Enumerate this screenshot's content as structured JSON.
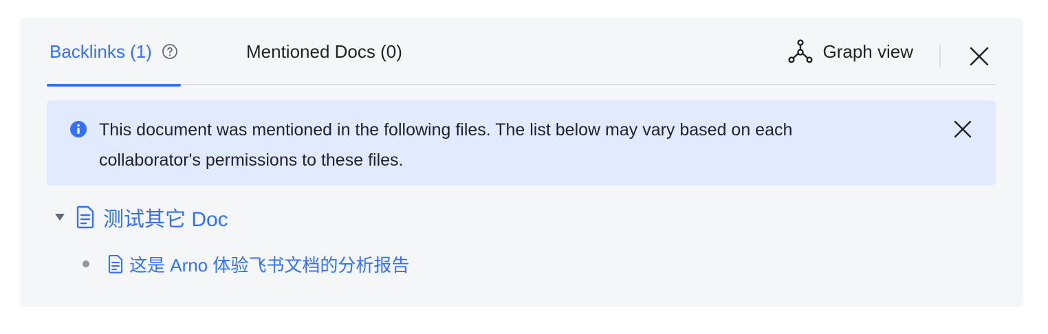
{
  "tabs": {
    "backlinks_label": "Backlinks (1)",
    "mentioned_label": "Mentioned Docs (0)"
  },
  "header": {
    "graph_view_label": "Graph view"
  },
  "notice": {
    "text": "This document was mentioned in the following files. The list below may vary based on each collaborator's permissions to these files."
  },
  "tree": {
    "root": {
      "title": "测试其它 Doc",
      "expanded": true,
      "children": [
        {
          "title": "这是 Arno 体验飞书文档的分析报告"
        }
      ]
    }
  },
  "colors": {
    "accent": "#3370ff",
    "panel_bg": "#f5f6f8",
    "notice_bg": "#e1eaff",
    "text": "#1f2329"
  },
  "icons": [
    "help-icon",
    "graph-icon",
    "close-icon",
    "info-icon",
    "caret-down-icon",
    "doc-icon"
  ]
}
